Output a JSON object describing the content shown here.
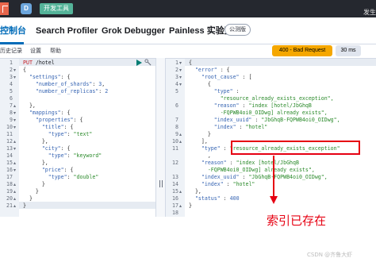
{
  "topbar": {
    "avatar_letter": "D",
    "breadcrumb": "开发工具",
    "corner_text": "发生"
  },
  "tabs": [
    {
      "label": "控制台",
      "active": true
    },
    {
      "label": "Search Profiler",
      "active": false
    },
    {
      "label": "Grok Debugger",
      "active": false
    },
    {
      "label": "Painless 实验室",
      "active": false
    }
  ],
  "beta_badge": "公测版",
  "toolbar": {
    "history": "历史记录",
    "settings": "设置",
    "help": "帮助"
  },
  "response_status": "400 - Bad Request",
  "response_time": "30 ms",
  "request_lines": [
    {
      "n": "1",
      "fold": "",
      "parts": [
        {
          "c": "m",
          "t": "PUT "
        },
        {
          "c": "u",
          "t": "/hotel"
        }
      ]
    },
    {
      "n": "2",
      "fold": "▾",
      "parts": [
        {
          "c": "p",
          "t": "{"
        }
      ]
    },
    {
      "n": "3",
      "fold": "▾",
      "parts": [
        {
          "c": "k",
          "t": "  \"settings\""
        },
        {
          "c": "p",
          "t": ": {"
        }
      ]
    },
    {
      "n": "4",
      "fold": "",
      "parts": [
        {
          "c": "k",
          "t": "    \"number_of_shards\""
        },
        {
          "c": "p",
          "t": ": "
        },
        {
          "c": "n",
          "t": "3"
        },
        {
          "c": "p",
          "t": ","
        }
      ]
    },
    {
      "n": "5",
      "fold": "",
      "parts": [
        {
          "c": "k",
          "t": "    \"number_of_replicas\""
        },
        {
          "c": "p",
          "t": ": "
        },
        {
          "c": "n",
          "t": "2"
        }
      ]
    },
    {
      "n": "6",
      "fold": "",
      "parts": [
        {
          "c": "p",
          "t": ""
        }
      ]
    },
    {
      "n": "7",
      "fold": "▴",
      "parts": [
        {
          "c": "p",
          "t": "  },"
        }
      ]
    },
    {
      "n": "8",
      "fold": "▾",
      "parts": [
        {
          "c": "k",
          "t": "  \"mappings\""
        },
        {
          "c": "p",
          "t": ": {"
        }
      ]
    },
    {
      "n": "9",
      "fold": "▾",
      "parts": [
        {
          "c": "k",
          "t": "    \"properties\""
        },
        {
          "c": "p",
          "t": ": {"
        }
      ]
    },
    {
      "n": "10",
      "fold": "▾",
      "parts": [
        {
          "c": "k",
          "t": "      \"title\""
        },
        {
          "c": "p",
          "t": ": {"
        }
      ]
    },
    {
      "n": "11",
      "fold": "",
      "parts": [
        {
          "c": "k",
          "t": "        \"type\""
        },
        {
          "c": "p",
          "t": ": "
        },
        {
          "c": "s",
          "t": "\"text\""
        }
      ]
    },
    {
      "n": "12",
      "fold": "▴",
      "parts": [
        {
          "c": "p",
          "t": "      },"
        }
      ]
    },
    {
      "n": "13",
      "fold": "▾",
      "parts": [
        {
          "c": "k",
          "t": "      \"city\""
        },
        {
          "c": "p",
          "t": ": {"
        }
      ]
    },
    {
      "n": "14",
      "fold": "",
      "parts": [
        {
          "c": "k",
          "t": "        \"type\""
        },
        {
          "c": "p",
          "t": ": "
        },
        {
          "c": "s",
          "t": "\"keyword\""
        }
      ]
    },
    {
      "n": "15",
      "fold": "▴",
      "parts": [
        {
          "c": "p",
          "t": "      },"
        }
      ]
    },
    {
      "n": "16",
      "fold": "▾",
      "parts": [
        {
          "c": "k",
          "t": "      \"price\""
        },
        {
          "c": "p",
          "t": ": {"
        }
      ]
    },
    {
      "n": "17",
      "fold": "",
      "parts": [
        {
          "c": "k",
          "t": "        \"type\""
        },
        {
          "c": "p",
          "t": ": "
        },
        {
          "c": "s",
          "t": "\"double\""
        }
      ]
    },
    {
      "n": "18",
      "fold": "▴",
      "parts": [
        {
          "c": "p",
          "t": "      }"
        }
      ]
    },
    {
      "n": "19",
      "fold": "▴",
      "parts": [
        {
          "c": "p",
          "t": "    }"
        }
      ]
    },
    {
      "n": "20",
      "fold": "▴",
      "parts": [
        {
          "c": "p",
          "t": "  }"
        }
      ]
    },
    {
      "n": "21",
      "fold": "▴",
      "parts": [
        {
          "c": "p",
          "t": "}"
        }
      ]
    }
  ],
  "response_lines": [
    {
      "n": "1",
      "fold": "▾",
      "parts": [
        {
          "c": "p",
          "t": "{"
        }
      ]
    },
    {
      "n": "2",
      "fold": "▾",
      "parts": [
        {
          "c": "k",
          "t": "  \"error\""
        },
        {
          "c": "p",
          "t": " : {"
        }
      ]
    },
    {
      "n": "3",
      "fold": "▾",
      "parts": [
        {
          "c": "k",
          "t": "    \"root_cause\""
        },
        {
          "c": "p",
          "t": " : ["
        }
      ]
    },
    {
      "n": "4",
      "fold": "▾",
      "parts": [
        {
          "c": "p",
          "t": "      {"
        }
      ]
    },
    {
      "n": "5",
      "fold": "",
      "parts": [
        {
          "c": "k",
          "t": "        \"type\""
        },
        {
          "c": "p",
          "t": " :"
        }
      ]
    },
    {
      "n": "",
      "fold": "",
      "parts": [
        {
          "c": "s",
          "t": "          \"resource_already_exists_exception\","
        }
      ]
    },
    {
      "n": "6",
      "fold": "",
      "parts": [
        {
          "c": "k",
          "t": "        \"reason\""
        },
        {
          "c": "p",
          "t": " : "
        },
        {
          "c": "s",
          "t": "\"index [hotel/JbGhqB"
        }
      ]
    },
    {
      "n": "",
      "fold": "",
      "parts": [
        {
          "c": "s",
          "t": "          -FQPWB4oi0_OIDwg] already exists\","
        }
      ]
    },
    {
      "n": "7",
      "fold": "",
      "parts": [
        {
          "c": "k",
          "t": "        \"index_uuid\""
        },
        {
          "c": "p",
          "t": " : "
        },
        {
          "c": "s",
          "t": "\"JbGhqB-FQPWB4oi0_OIDwg\","
        }
      ]
    },
    {
      "n": "8",
      "fold": "",
      "parts": [
        {
          "c": "k",
          "t": "        \"index\""
        },
        {
          "c": "p",
          "t": " : "
        },
        {
          "c": "s",
          "t": "\"hotel\""
        }
      ]
    },
    {
      "n": "9",
      "fold": "▴",
      "parts": [
        {
          "c": "p",
          "t": "      }"
        }
      ]
    },
    {
      "n": "10",
      "fold": "▴",
      "parts": [
        {
          "c": "p",
          "t": "    ],"
        }
      ]
    },
    {
      "n": "11",
      "fold": "",
      "parts": [
        {
          "c": "k",
          "t": "    \"type\""
        },
        {
          "c": "p",
          "t": " : "
        },
        {
          "c": "s",
          "t": "\"resource_already_exists_exception\""
        }
      ]
    },
    {
      "n": "",
      "fold": "",
      "parts": [
        {
          "c": "p",
          "t": "      ,"
        }
      ]
    },
    {
      "n": "12",
      "fold": "",
      "parts": [
        {
          "c": "k",
          "t": "    \"reason\""
        },
        {
          "c": "p",
          "t": " : "
        },
        {
          "c": "s",
          "t": "\"index [hotel/JbGhqB"
        }
      ]
    },
    {
      "n": "",
      "fold": "",
      "parts": [
        {
          "c": "s",
          "t": "      -FQPWB4oi0_OIDwg] already exists\","
        }
      ]
    },
    {
      "n": "13",
      "fold": "",
      "parts": [
        {
          "c": "k",
          "t": "    \"index_uuid\""
        },
        {
          "c": "p",
          "t": " : "
        },
        {
          "c": "s",
          "t": "\"JbGhqB-FQPWB4oi0_OIDwg\","
        }
      ]
    },
    {
      "n": "14",
      "fold": "",
      "parts": [
        {
          "c": "k",
          "t": "    \"index\""
        },
        {
          "c": "p",
          "t": " : "
        },
        {
          "c": "s",
          "t": "\"hotel\""
        }
      ]
    },
    {
      "n": "15",
      "fold": "▴",
      "parts": [
        {
          "c": "p",
          "t": "  },"
        }
      ]
    },
    {
      "n": "16",
      "fold": "",
      "parts": [
        {
          "c": "k",
          "t": "  \"status\""
        },
        {
          "c": "p",
          "t": " : "
        },
        {
          "c": "n",
          "t": "400"
        }
      ]
    },
    {
      "n": "17",
      "fold": "▴",
      "parts": [
        {
          "c": "p",
          "t": "}"
        }
      ]
    },
    {
      "n": "18",
      "fold": "",
      "parts": [
        {
          "c": "p",
          "t": ""
        }
      ]
    }
  ],
  "annotation": "索引已存在",
  "watermark": "CSDN @齐鲁大虾",
  "colors": {
    "accent": "#006bb8",
    "status_warning": "#f5a700",
    "annotation_red": "#e60012",
    "json_key": "#3765b3",
    "json_string": "#2a8a2a",
    "http_method": "#c61e25"
  }
}
